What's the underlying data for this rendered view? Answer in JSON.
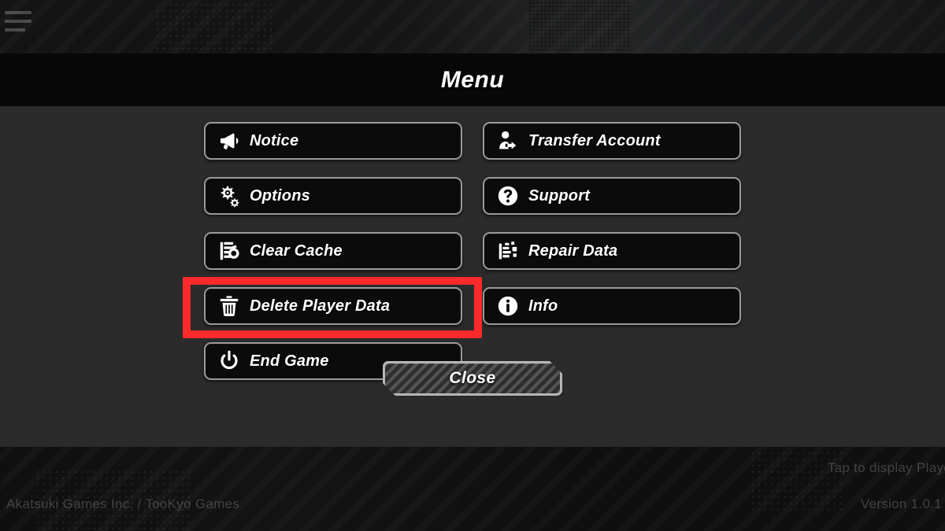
{
  "background": {
    "menu_icon": "hamburger-menu-icon",
    "tap_hint": "Tap to display Player",
    "credit": "Akatsuki Games Inc. / TooKyo Games",
    "version": "Version 1.0.1"
  },
  "panel": {
    "title": "Menu",
    "accent_highlight_color": "#fc2a2a",
    "button_border_color": "#9a9a9a",
    "button_fill_color": "#0b0b0b",
    "text_color": "#ffffff"
  },
  "menu": {
    "buttons": [
      {
        "label": "Notice",
        "icon": "megaphone-icon",
        "column": "left",
        "highlighted": false
      },
      {
        "label": "Transfer Account",
        "icon": "person-transfer-icon",
        "column": "right",
        "highlighted": false
      },
      {
        "label": "Options",
        "icon": "gears-icon",
        "column": "left",
        "highlighted": false
      },
      {
        "label": "Support",
        "icon": "question-circle-icon",
        "column": "right",
        "highlighted": false
      },
      {
        "label": "Clear Cache",
        "icon": "document-refresh-icon",
        "column": "left",
        "highlighted": false
      },
      {
        "label": "Repair Data",
        "icon": "document-repair-icon",
        "column": "right",
        "highlighted": false
      },
      {
        "label": "Delete Player Data",
        "icon": "trash-icon",
        "column": "left",
        "highlighted": true
      },
      {
        "label": "Info",
        "icon": "info-circle-icon",
        "column": "right",
        "highlighted": false
      },
      {
        "label": "End Game",
        "icon": "power-icon",
        "column": "left",
        "highlighted": false
      }
    ],
    "close_label": "Close"
  }
}
